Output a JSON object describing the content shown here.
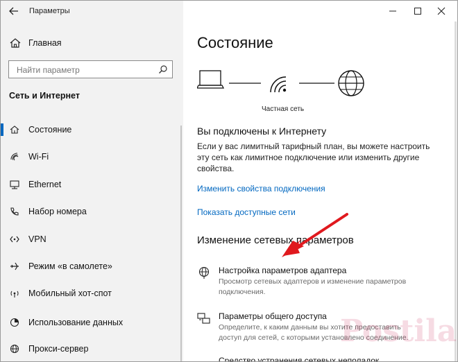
{
  "window": {
    "title": "Параметры"
  },
  "sidebar": {
    "home_label": "Главная",
    "search_placeholder": "Найти параметр",
    "section_title": "Сеть и Интернет",
    "items": [
      {
        "label": "Состояние",
        "icon": "home-network-icon",
        "active": true
      },
      {
        "label": "Wi-Fi",
        "icon": "wifi-icon"
      },
      {
        "label": "Ethernet",
        "icon": "ethernet-icon"
      },
      {
        "label": "Набор номера",
        "icon": "phone-icon"
      },
      {
        "label": "VPN",
        "icon": "vpn-icon"
      },
      {
        "label": "Режим «в самолете»",
        "icon": "airplane-icon"
      },
      {
        "label": "Мобильный хот-спот",
        "icon": "hotspot-icon"
      },
      {
        "label": "Использование данных",
        "icon": "data-usage-icon"
      },
      {
        "label": "Прокси-сервер",
        "icon": "globe-icon"
      }
    ]
  },
  "main": {
    "title": "Состояние",
    "network_label": "Частная сеть",
    "connected_heading": "Вы подключены к Интернету",
    "connected_text": "Если у вас лимитный тарифный план, вы можете настроить эту сеть как лимитное подключение или изменить другие свойства.",
    "link_properties": "Изменить свойства подключения",
    "link_networks": "Показать доступные сети",
    "change_heading": "Изменение сетевых параметров",
    "options": [
      {
        "title": "Настройка параметров адаптера",
        "desc": "Просмотр сетевых адаптеров и изменение параметров подключения.",
        "icon": "adapter-globe-icon"
      },
      {
        "title": "Параметры общего доступа",
        "desc": "Определите, к каким данным вы хотите предоставить доступ для сетей, с которыми установлено соединение.",
        "icon": "sharing-icon"
      },
      {
        "title": "Средство устранения сетевых неполадок",
        "icon": "troubleshoot-icon"
      }
    ]
  },
  "annotation": {
    "arrow_color": "#e0191e"
  },
  "watermark": {
    "text": "Postila.ru"
  },
  "colors": {
    "accent": "#0067c0",
    "sidebar_bg": "#f2f2f2"
  }
}
